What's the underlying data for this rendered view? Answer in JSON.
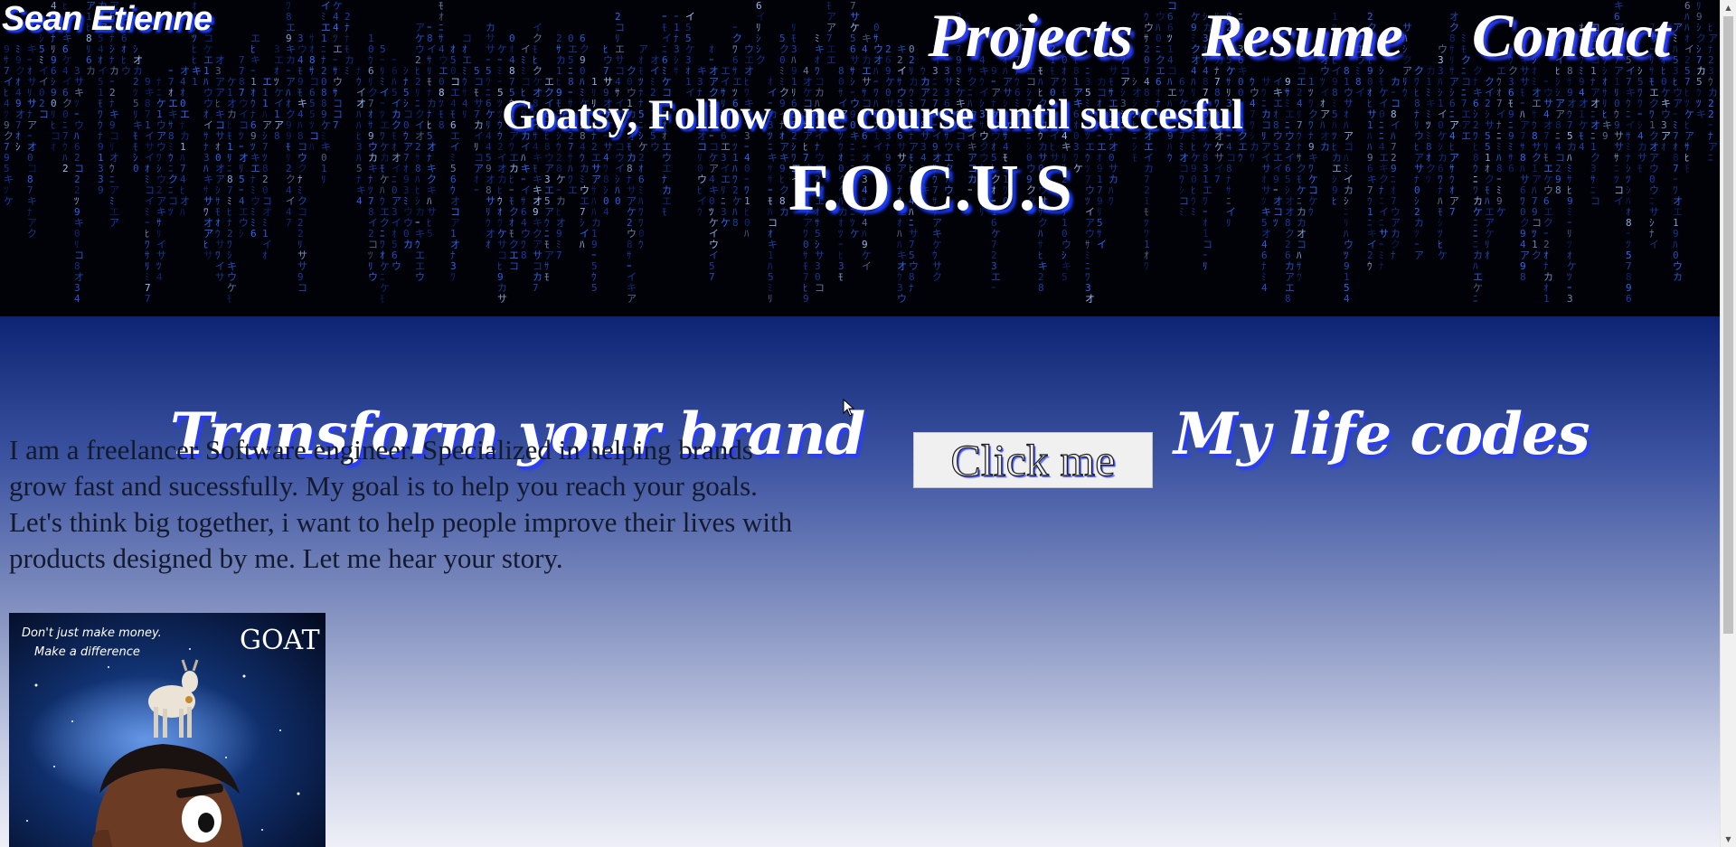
{
  "header": {
    "brand": "Sean Etienne",
    "nav": [
      {
        "label": "Projects"
      },
      {
        "label": "Resume"
      },
      {
        "label": "Contact"
      }
    ],
    "tagline": "Goatsy, Follow one course until succesful",
    "motto": "F.O.C.U.S"
  },
  "main": {
    "left_heading": "Transform your brand",
    "right_heading": "My life codes",
    "about_text": "I am a freelancer Software engineer. Specialized in helping brands grow fast and sucessfully. My goal is to help you reach your goals. Let's think big together, i want to help people improve their lives with products designed by me. Let me hear your story.",
    "button_label": "Click me",
    "image": {
      "caption_line1": "Don't just make money.",
      "caption_line2": "Make a difference",
      "badge": "GOAT"
    }
  },
  "colors": {
    "accent_shadow": "#1b3cff",
    "matrix_glyph": "#2f6bff",
    "gradient_top": "#0d2474",
    "gradient_bottom": "#eeeff7"
  },
  "icons": [
    "matrix-background-icon",
    "mouse-cursor-icon",
    "scroll-up-icon",
    "scroll-down-icon"
  ]
}
